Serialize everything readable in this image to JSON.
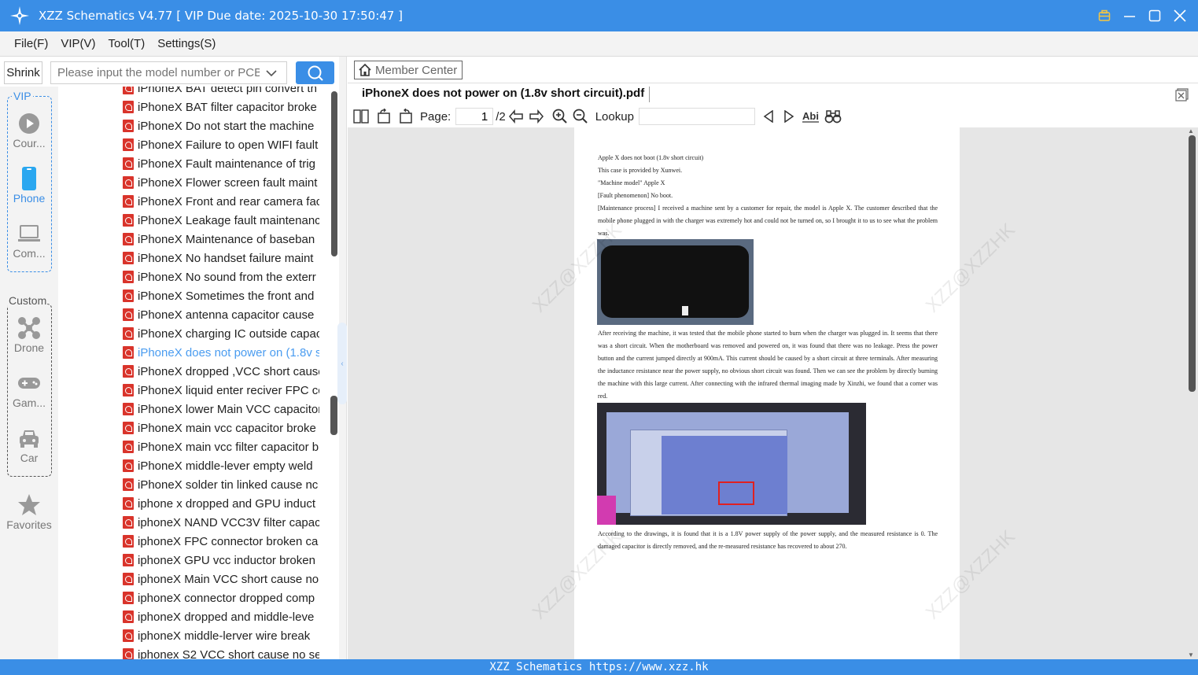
{
  "window": {
    "title": "XZZ Schematics V4.77 [ VIP Due date: 2025-10-30 17:50:47 ]"
  },
  "menu": [
    "File(F)",
    "VIP(V)",
    "Tool(T)",
    "Settings(S)"
  ],
  "search": {
    "shrink_label": "Shrink",
    "placeholder": "Please input the model number or PCB"
  },
  "sidebar": {
    "vip_label": "VIP",
    "custom_label": "Custom",
    "items": [
      {
        "label": "Cour...",
        "icon": "play-circle-icon"
      },
      {
        "label": "Phone",
        "icon": "phone-icon"
      },
      {
        "label": "Com...",
        "icon": "laptop-icon"
      },
      {
        "label": "Drone",
        "icon": "drone-icon"
      },
      {
        "label": "Gam...",
        "icon": "gamepad-icon"
      },
      {
        "label": "Car",
        "icon": "car-icon"
      },
      {
        "label": "Favorites",
        "icon": "star-icon"
      }
    ]
  },
  "file_list": [
    "iPhoneX BAT detect pin convert th",
    "iPhoneX BAT filter capacitor broke",
    "iPhoneX Do not start the machine",
    "iPhoneX Failure to open WIFI fault",
    "iPhoneX Fault maintenance of trig",
    "iPhoneX Flower screen fault maint",
    "iPhoneX Front and rear camera fac",
    "iPhoneX Leakage fault maintenanc",
    "iPhoneX Maintenance of baseban",
    "iPhoneX No handset failure maint",
    "iPhoneX No sound from the exterr",
    "iPhoneX Sometimes the front and",
    "iPhoneX antenna capacitor cause",
    "iPhoneX charging IC outside capac",
    "iPhoneX does not power on (1.8v s",
    "iPhoneX dropped ,VCC short cause",
    "iPhoneX liquid enter reciver FPC cc",
    "iPhoneX lower Main VCC capacitor",
    "iPhoneX main vcc capacitor broke",
    "iPhoneX main vcc filter capacitor b",
    "iPhoneX middle-lever empty weld",
    "iPhoneX solder tin linked cause nc",
    "iphone x dropped and GPU induct",
    "iphoneX  NAND VCC3V filter capac",
    "iphoneX FPC connector broken ca",
    "iphoneX GPU vcc inductor broken",
    "iphoneX Main VCC short cause no",
    "iphoneX connector dropped comp",
    "iphoneX dropped and middle-leve",
    "iphoneX middle-lerver wire break",
    "iphonex S2 VCC short cause no ser"
  ],
  "selected_index": 14,
  "viewer": {
    "member_center": "Member Center",
    "doc_tab": "iPhoneX does not power on (1.8v short circuit).pdf",
    "page_label": "Page:",
    "page_current": "1",
    "page_total": "/2",
    "lookup_label": "Lookup"
  },
  "document": {
    "lines": [
      "Apple X does not boot (1.8v short circuit)",
      "This case is provided by Xunwei.",
      "\"Machine model\" Apple X",
      "[Fault phenomenon] No boot."
    ],
    "para1": "[Maintenance process] I received a machine sent by a customer for repair, the model is Apple X. The customer described that the mobile phone plugged in with the charger was extremely hot and could not be turned on, so I brought it to us to see what the problem was.",
    "para2": "After receiving the machine, it was tested that the mobile phone started to burn when the charger was plugged in. It seems that there was a short circuit. When the motherboard was removed and powered on, it was found that there was no leakage. Press the power button and the current jumped directly at 900mA. This current should be caused by a short circuit at three terminals. After measuring the inductance resistance near the power supply, no obvious short circuit was found. Then we can see the problem by directly burning the machine with this large current. After connecting with the infrared thermal imaging made by Xinzhi, we found that a corner was red.",
    "para3": "According to the drawings, it is found that it is a 1.8V power supply of the power supply, and the measured resistance is 0. The damaged capacitor is directly removed, and the re-measured resistance has recovered to about 270.",
    "watermark": "XZZ@XZZHK"
  },
  "statusbar": "XZZ Schematics https://www.xzz.hk",
  "colors": {
    "accent": "#3a8ee6",
    "pdf_red": "#d9342b",
    "selected": "#4a9cf0"
  }
}
